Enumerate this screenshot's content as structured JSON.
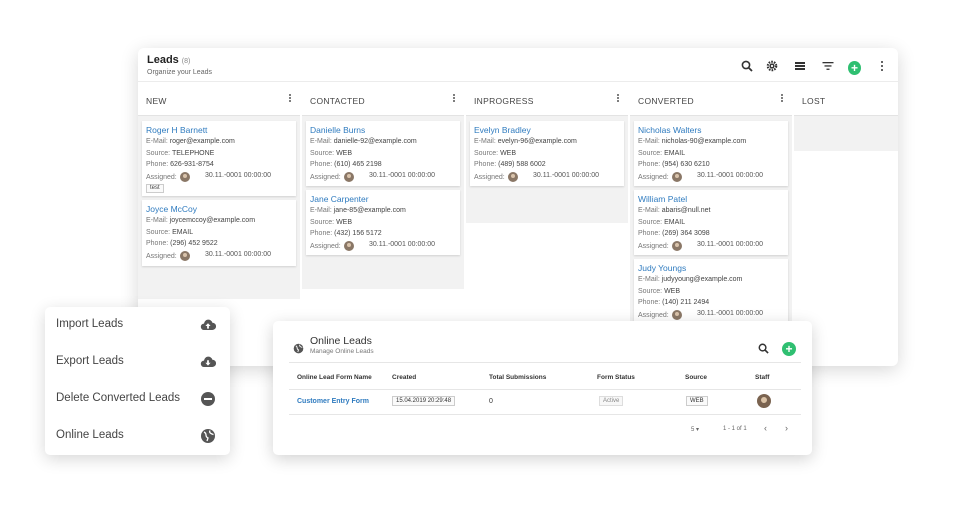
{
  "board": {
    "title": "Leads",
    "count": "(8)",
    "subtitle": "Organize your Leads",
    "add_icon": "+",
    "columns": [
      {
        "title": "NEW",
        "cards": [
          {
            "name": "Roger H Barnett",
            "email_label": "E-Mail:",
            "email": "roger@example.com",
            "source_label": "Source:",
            "source": "TELEPHONE",
            "phone_label": "Phone:",
            "phone": "626-931-8754",
            "assigned_label": "Assigned:",
            "date": "30.11.-0001 00:00:00",
            "tag": "test"
          },
          {
            "name": "Joyce McCoy",
            "email_label": "E-Mail:",
            "email": "joycemccoy@example.com",
            "source_label": "Source:",
            "source": "EMAIL",
            "phone_label": "Phone:",
            "phone": "(296) 452 9522",
            "assigned_label": "Assigned:",
            "date": "30.11.-0001 00:00:00"
          }
        ]
      },
      {
        "title": "CONTACTED",
        "cards": [
          {
            "name": "Danielle Burns",
            "email_label": "E-Mail:",
            "email": "danielle-92@example.com",
            "source_label": "Source:",
            "source": "WEB",
            "phone_label": "Phone:",
            "phone": "(610) 465 2198",
            "assigned_label": "Assigned:",
            "date": "30.11.-0001 00:00:00"
          },
          {
            "name": "Jane Carpenter",
            "email_label": "E-Mail:",
            "email": "jane-85@example.com",
            "source_label": "Source:",
            "source": "WEB",
            "phone_label": "Phone:",
            "phone": "(432) 156 5172",
            "assigned_label": "Assigned:",
            "date": "30.11.-0001 00:00:00"
          }
        ]
      },
      {
        "title": "INPROGRESS",
        "cards": [
          {
            "name": "Evelyn Bradley",
            "email_label": "E-Mail:",
            "email": "evelyn-96@example.com",
            "source_label": "Source:",
            "source": "WEB",
            "phone_label": "Phone:",
            "phone": "(489) 588 6002",
            "assigned_label": "Assigned:",
            "date": "30.11.-0001 00:00:00"
          }
        ]
      },
      {
        "title": "CONVERTED",
        "cards": [
          {
            "name": "Nicholas Walters",
            "email_label": "E-Mail:",
            "email": "nicholas-90@example.com",
            "source_label": "Source:",
            "source": "EMAIL",
            "phone_label": "Phone:",
            "phone": "(954) 630 6210",
            "assigned_label": "Assigned:",
            "date": "30.11.-0001 00:00:00"
          },
          {
            "name": "William Patel",
            "email_label": "E-Mail:",
            "email": "abaris@null.net",
            "source_label": "Source:",
            "source": "EMAIL",
            "phone_label": "Phone:",
            "phone": "(269) 364 3098",
            "assigned_label": "Assigned:",
            "date": "30.11.-0001 00:00:00"
          },
          {
            "name": "Judy Youngs",
            "email_label": "E-Mail:",
            "email": "judyyoung@example.com",
            "source_label": "Source:",
            "source": "WEB",
            "phone_label": "Phone:",
            "phone": "(140) 211 2494",
            "assigned_label": "Assigned:",
            "date": "30.11.-0001 00:00:00"
          }
        ]
      },
      {
        "title": "LOST",
        "cards": []
      }
    ]
  },
  "side_menu": {
    "items": [
      {
        "label": "Import Leads",
        "icon": "cloud-upload-icon"
      },
      {
        "label": "Export Leads",
        "icon": "cloud-download-icon"
      },
      {
        "label": "Delete Converted Leads",
        "icon": "minus-circle-icon"
      },
      {
        "label": "Online Leads",
        "icon": "globe-icon"
      }
    ]
  },
  "online_leads": {
    "title": "Online Leads",
    "subtitle": "Manage Online Leads",
    "add_icon": "+",
    "columns": [
      "Online Lead Form Name",
      "Created",
      "Total Submissions",
      "Form Status",
      "Source",
      "Staff"
    ],
    "rows": [
      {
        "form_name": "Customer Entry Form",
        "created": "15.04.2019 20:29:48",
        "total": "0",
        "status": "Active",
        "source": "WEB"
      }
    ],
    "pager": {
      "per_page": "5",
      "per_page_arrow": "▾",
      "range": "1 - 1 of 1",
      "prev": "‹",
      "next": "›"
    }
  },
  "colors": {
    "accent": "#2f7bbf",
    "green": "#2fbf71"
  }
}
